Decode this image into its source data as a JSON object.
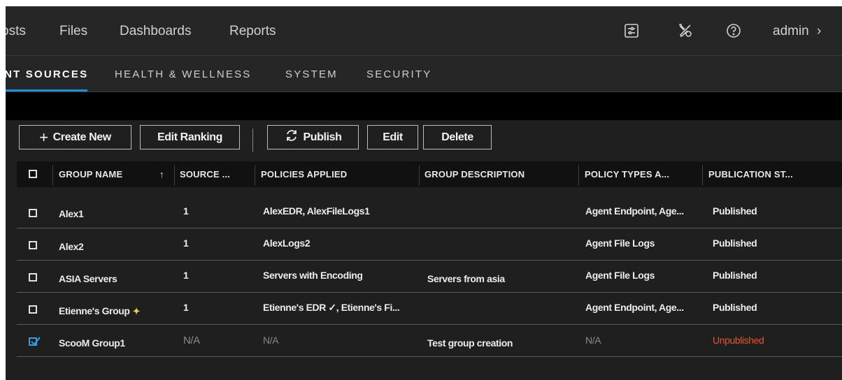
{
  "nav": {
    "items": [
      "osts",
      "Files",
      "Dashboards",
      "Reports"
    ],
    "user": "admin",
    "icons": [
      "settings-sliders-icon",
      "tools-icon",
      "help-icon"
    ]
  },
  "tabs": [
    {
      "label": "NT SOURCES",
      "active": true
    },
    {
      "label": "HEALTH & WELLNESS",
      "active": false
    },
    {
      "label": "SYSTEM",
      "active": false
    },
    {
      "label": "SECURITY",
      "active": false
    }
  ],
  "toolbar": {
    "create_new": "Create New",
    "edit_ranking": "Edit Ranking",
    "publish": "Publish",
    "edit": "Edit",
    "delete": "Delete"
  },
  "table": {
    "columns": [
      "GROUP NAME",
      "SOURCE ...",
      "POLICIES APPLIED",
      "GROUP DESCRIPTION",
      "POLICY TYPES A...",
      "PUBLICATION ST..."
    ],
    "sort_indicator": "↑",
    "rows": [
      {
        "name": "Alex1",
        "source": "1",
        "policies": "AlexEDR, AlexFileLogs1",
        "description": "",
        "types": "Agent Endpoint, Age...",
        "status": "Published",
        "checked": false
      },
      {
        "name": "Alex2",
        "source": "1",
        "policies": "AlexLogs2",
        "description": "",
        "types": "Agent File Logs",
        "status": "Published",
        "checked": false
      },
      {
        "name": "ASIA Servers",
        "source": "1",
        "policies": "Servers with Encoding",
        "description": "Servers from asia",
        "types": "Agent File Logs",
        "status": "Published",
        "checked": false
      },
      {
        "name": "Etienne's Group",
        "source": "1",
        "policies": "Etienne's EDR ✓, Etienne's Fi...",
        "description": "",
        "types": "Agent Endpoint, Age...",
        "status": "Published",
        "checked": false
      },
      {
        "name": "ScooM Group1",
        "source": "N/A",
        "policies": "N/A",
        "description": "Test group creation",
        "types": "N/A",
        "status": "Unpublished",
        "checked": true
      }
    ]
  },
  "colors": {
    "accent": "#1e8fd6",
    "unpublished": "#e0552b",
    "checkbox_checked": "#3a9be0",
    "sparkle": "#f5d34a"
  }
}
